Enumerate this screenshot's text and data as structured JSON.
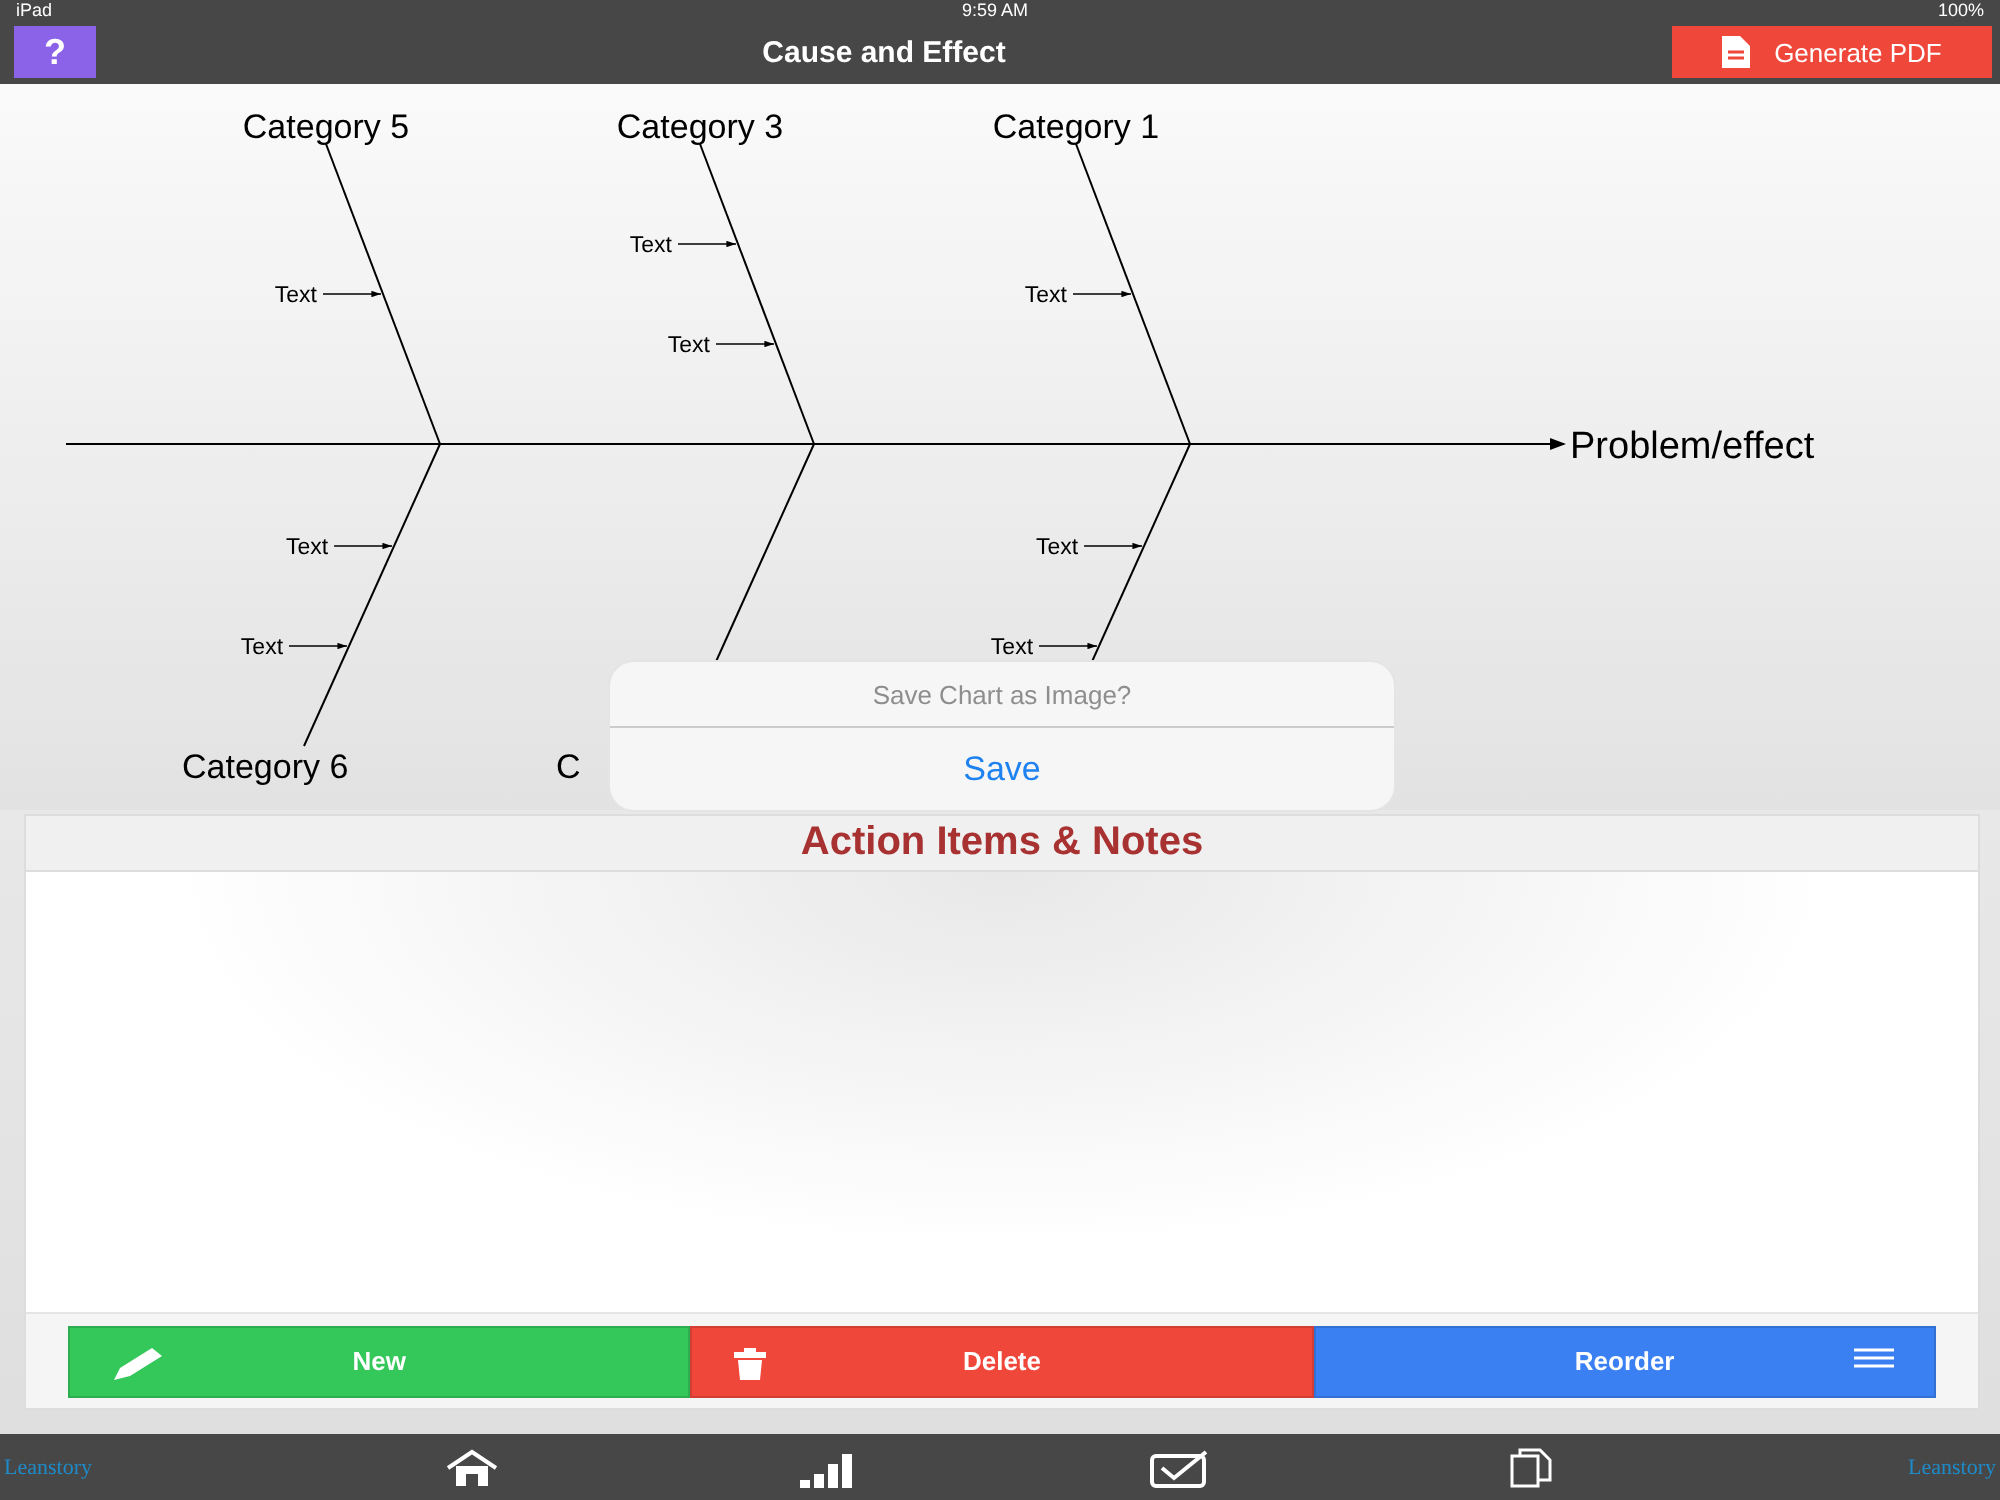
{
  "status_bar": {
    "device": "iPad",
    "time": "9:59 AM",
    "battery": "100%"
  },
  "nav": {
    "help_button": "?",
    "title": "Cause and Effect",
    "pdf_button": "Generate PDF"
  },
  "diagram": {
    "effect": "Problem/effect",
    "branches": [
      {
        "kind": "top",
        "label": "Category 5",
        "causes": [
          "Text"
        ]
      },
      {
        "kind": "top",
        "label": "Category 3",
        "causes": [
          "Text",
          "Text"
        ]
      },
      {
        "kind": "top",
        "label": "Category 1",
        "causes": [
          "Text"
        ]
      },
      {
        "kind": "bottom",
        "label": "Category 6",
        "causes": [
          "Text",
          "Text"
        ]
      },
      {
        "kind": "bottom",
        "label": "C"
      },
      {
        "kind": "bottom",
        "causes": [
          "Text",
          "Text"
        ]
      }
    ]
  },
  "dialog": {
    "message": "Save Chart as Image?",
    "action": "Save"
  },
  "notes_panel": {
    "title": "Action Items & Notes",
    "buttons": [
      {
        "kind": "new",
        "label": "New"
      },
      {
        "kind": "delete",
        "label": "Delete"
      },
      {
        "kind": "reorder",
        "label": "Reorder"
      }
    ]
  },
  "tab_bar": {
    "logos": [
      "Leanstory",
      "Leanstory"
    ],
    "tabs": [
      {
        "kind": "home"
      },
      {
        "kind": "chart"
      },
      {
        "kind": "tasks"
      },
      {
        "kind": "documents"
      }
    ]
  }
}
